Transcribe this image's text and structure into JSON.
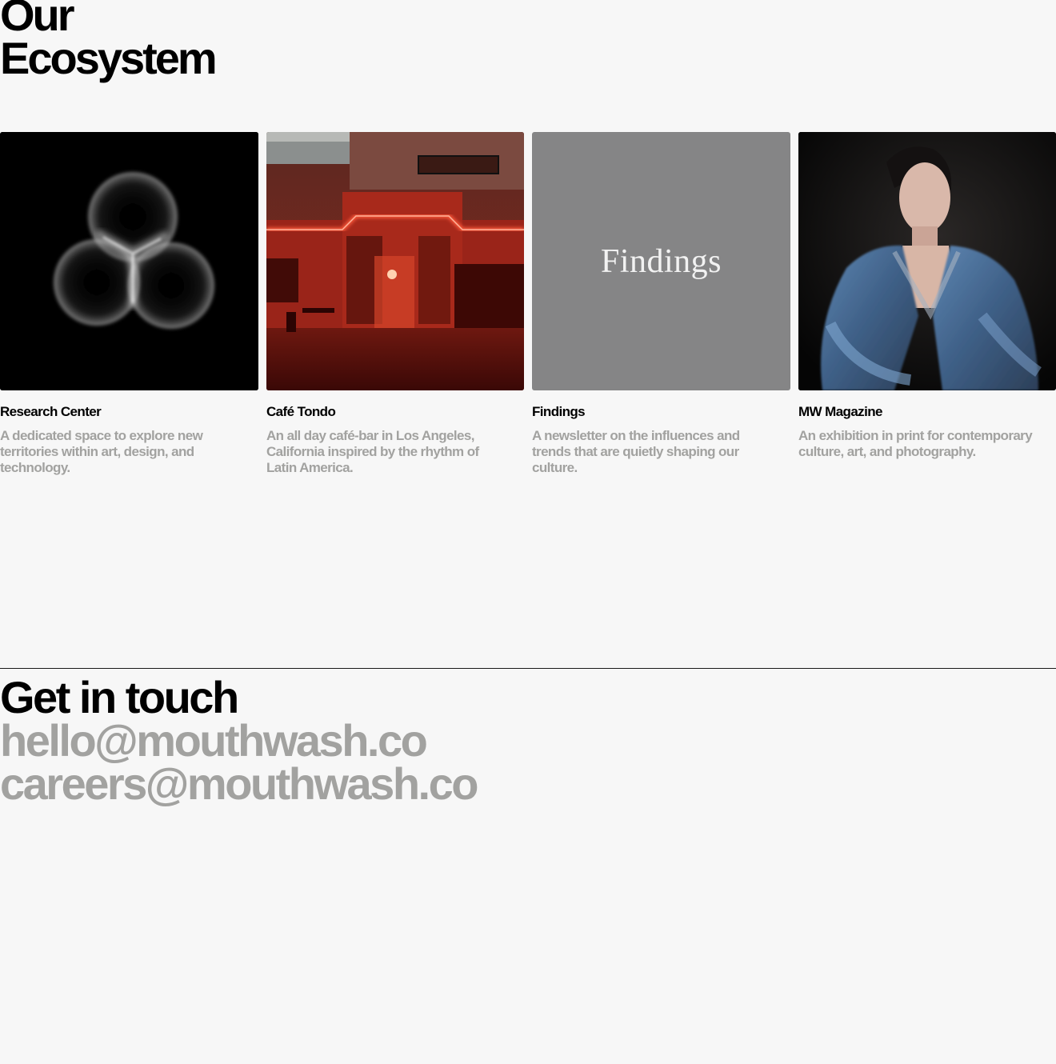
{
  "hero": {
    "line1": "Our",
    "line2": "Ecosystem"
  },
  "ecosystem": [
    {
      "title": "Research Center",
      "description": "A dedicated space to explore new territories within art, design, and technology."
    },
    {
      "title": "Café Tondo",
      "description": "An all day café-bar in Los Angeles, California inspired by the rhythm of Latin America."
    },
    {
      "title": "Findings",
      "description": "A newsletter on the influences and trends that are quietly shaping our culture.",
      "logo_text": "Findings"
    },
    {
      "title": "MW Magazine",
      "description": "An exhibition in print for contemporary culture, art, and photography."
    }
  ],
  "contact": {
    "title": "Get in touch",
    "email_hello": "hello@mouthwash.co",
    "email_careers": "careers@mouthwash.co"
  },
  "colors": {
    "background": "#f7f7f7",
    "text": "#000000",
    "muted": "#a2a2a0",
    "findings_tile": "#858586"
  }
}
